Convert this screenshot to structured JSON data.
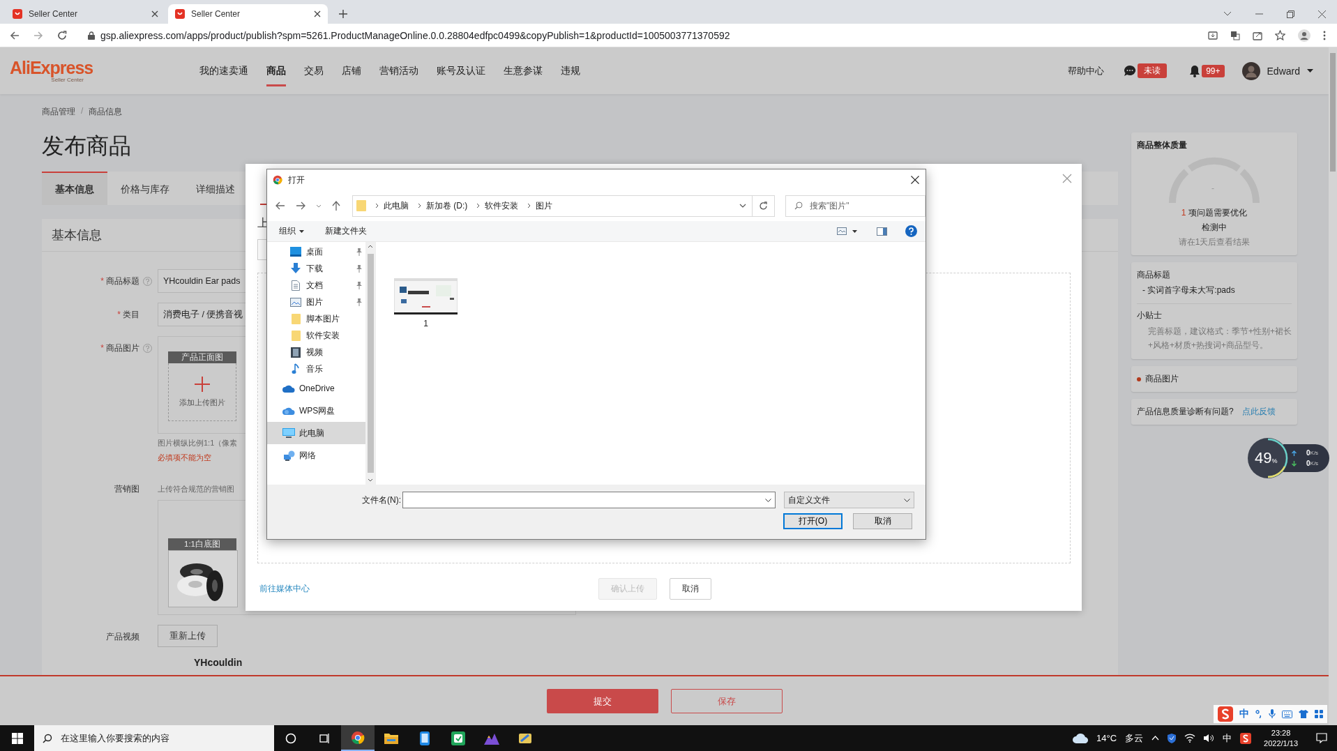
{
  "browser": {
    "tabs": [
      {
        "title": "Seller Center",
        "selected": false
      },
      {
        "title": "Seller Center",
        "selected": true
      }
    ],
    "url": "gsp.aliexpress.com/apps/product/publish?spm=5261.ProductManageOnline.0.0.28804edfpc0499&copyPublish=1&productId=1005003771370592"
  },
  "header": {
    "logo": "AliExpress",
    "logo_sub": "Seller Center",
    "nav": [
      {
        "label": "我的速卖通",
        "selected": false
      },
      {
        "label": "商品",
        "selected": true
      },
      {
        "label": "交易",
        "selected": false
      },
      {
        "label": "店铺",
        "selected": false
      },
      {
        "label": "营销活动",
        "selected": false
      },
      {
        "label": "账号及认证",
        "selected": false
      },
      {
        "label": "生意参谋",
        "selected": false
      },
      {
        "label": "违规",
        "selected": false
      }
    ],
    "help": "帮助中心",
    "message_badge": "未读",
    "notice_badge": "99+",
    "user": "Edward"
  },
  "breadcrumb": {
    "items": [
      "商品管理",
      "商品信息"
    ],
    "separator": "/"
  },
  "page_title": "发布商品",
  "tabs": [
    {
      "label": "基本信息",
      "selected": true
    },
    {
      "label": "价格与库存",
      "selected": false
    },
    {
      "label": "详细描述",
      "selected": false
    }
  ],
  "section_title": "基本信息",
  "required_mark": "*",
  "fields": [
    {
      "kind": "text",
      "label": "商品标题",
      "required": true,
      "help": true,
      "value": "YHcouldin Ear pads"
    },
    {
      "kind": "text",
      "label": "类目",
      "required": true,
      "help": false,
      "value": "消费电子 / 便携音视"
    },
    {
      "kind": "images",
      "label": "商品图片",
      "required": true,
      "help": true,
      "slot": "产品正面图",
      "add_text": "添加上传图片",
      "hint": "图片横纵比例1:1（像素",
      "error": "必填项不能为空"
    },
    {
      "kind": "marketing",
      "label": "营销图",
      "required": false,
      "help": false,
      "hint": "上传符合规范的营销图",
      "slot": "1:1白底图"
    },
    {
      "kind": "video",
      "label": "产品视频",
      "required": false,
      "help": false,
      "button": "重新上传",
      "caption": "YHcouldin"
    }
  ],
  "side": {
    "quality": {
      "title": "商品整体质量",
      "reading": "-",
      "issue_count": "1",
      "issue_text": "项问题需要优化",
      "status": "检测中",
      "note": "请在1天后查看结果"
    },
    "title_check": {
      "title": "商品标题",
      "issue": "- 实词首字母未大写:pads",
      "tips_title": "小贴士",
      "tips": "完善标题，建议格式：季节+性别+裙长+风格+材质+热搜词+商品型号。"
    },
    "image_check": {
      "label": "商品图片"
    },
    "feedback": {
      "text": "产品信息质量诊断有问题?",
      "link": "点此反馈"
    }
  },
  "actions": {
    "submit": "提交",
    "save": "保存"
  },
  "upload_modal": {
    "tab": "上",
    "link": "前往媒体中心",
    "confirm": {
      "label": "确认上传",
      "disabled": true
    },
    "cancel": "取消"
  },
  "open_dialog": {
    "title": "打开",
    "path": [
      "此电脑",
      "新加卷 (D:)",
      "软件安装",
      "图片"
    ],
    "search_placeholder": "搜索\"图片\"",
    "organize": "组织",
    "new_folder": "新建文件夹",
    "nav": [
      {
        "label": "桌面",
        "kind": "desktop",
        "pinned": true,
        "selected": false
      },
      {
        "label": "下载",
        "kind": "download",
        "pinned": true,
        "selected": false
      },
      {
        "label": "文档",
        "kind": "document",
        "pinned": true,
        "selected": false
      },
      {
        "label": "图片",
        "kind": "pictures",
        "pinned": true,
        "selected": false
      },
      {
        "label": "脚本图片",
        "kind": "folder",
        "pinned": false,
        "selected": false
      },
      {
        "label": "软件安装",
        "kind": "folder",
        "pinned": false,
        "selected": false
      },
      {
        "label": "视频",
        "kind": "video",
        "pinned": false,
        "selected": false
      },
      {
        "label": "音乐",
        "kind": "music",
        "pinned": false,
        "selected": false
      },
      {
        "label": "OneDrive",
        "kind": "onedrive",
        "pinned": false,
        "selected": false
      },
      {
        "label": "WPS网盘",
        "kind": "cloud",
        "pinned": false,
        "selected": false
      },
      {
        "label": "此电脑",
        "kind": "computer",
        "pinned": false,
        "selected": true
      },
      {
        "label": "网络",
        "kind": "network",
        "pinned": false,
        "selected": false
      }
    ],
    "files": [
      {
        "name": "1"
      }
    ],
    "filename_label": "文件名(N):",
    "filetype": "自定义文件",
    "open": "打开(O)",
    "cancel": "取消"
  },
  "net_monitor": {
    "cpu": "49",
    "cpu_unit": "%",
    "up": "0",
    "up_unit": "K/s",
    "down": "0",
    "down_unit": "K/s"
  },
  "ime_bar": {
    "mode": "中"
  },
  "taskbar": {
    "search_placeholder": "在这里输入你要搜索的内容",
    "apps": [
      {
        "kind": "cortana",
        "active": false
      },
      {
        "kind": "taskview",
        "active": false
      },
      {
        "kind": "chrome",
        "active": true
      },
      {
        "kind": "explorer",
        "active": false
      },
      {
        "kind": "phone",
        "active": false
      },
      {
        "kind": "sheet",
        "active": false
      },
      {
        "kind": "mountains",
        "active": false
      },
      {
        "kind": "tool",
        "active": false
      }
    ],
    "temperature": "14°C",
    "weather": "多云",
    "ime": "中",
    "time": "23:28",
    "date": "2022/1/13"
  }
}
